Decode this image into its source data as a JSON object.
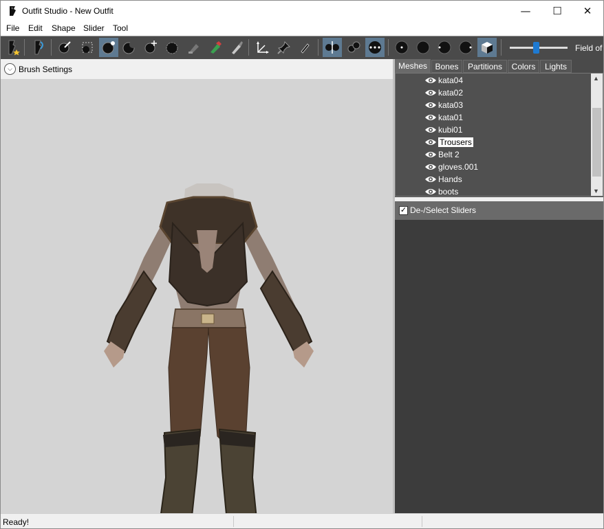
{
  "window": {
    "title": "Outfit Studio - New Outfit",
    "minimize": "—",
    "maximize": "☐",
    "close": "✕"
  },
  "menu": [
    "File",
    "Edit",
    "Shape",
    "Slider",
    "Tool"
  ],
  "toolbar": {
    "icons": [
      "new-project-icon",
      "load-outfit-icon",
      "select-brush-icon",
      "mask-brush-icon",
      "inflate-brush-icon",
      "deflate-brush-icon",
      "move-brush-icon",
      "smooth-brush-icon",
      "undiff-brush-icon",
      "weight-brush-icon",
      "color-brush-icon",
      "collision-icon",
      "pin-icon",
      "edit-icon",
      "x-mirror-icon",
      "connected-only-icon",
      "global-brush-icon",
      "view-front-icon",
      "view-back-icon",
      "view-left-icon",
      "view-right-icon",
      "perspective-icon"
    ],
    "field_of_view_label": "Field of",
    "field_of_view_value": 0.45
  },
  "brush_settings": {
    "label": "Brush Settings"
  },
  "tabs": [
    "Meshes",
    "Bones",
    "Partitions",
    "Colors",
    "Lights"
  ],
  "active_tab": "Meshes",
  "meshes": [
    "kata04",
    "kata02",
    "kata03",
    "kata01",
    "kubi01",
    "Trousers",
    "Belt 2",
    "gloves.001",
    "Hands",
    "boots"
  ],
  "selected_mesh": "Trousers",
  "sliders": {
    "deselect_label": "De-/Select Sliders",
    "checked": true
  },
  "status": {
    "text": "Ready!"
  },
  "colors": {
    "toolbar_bg": "#4a4a4a",
    "toggle_on": "#5e7a92",
    "viewport_bg": "#d4d4d4",
    "accent": "#1e7ad2"
  }
}
